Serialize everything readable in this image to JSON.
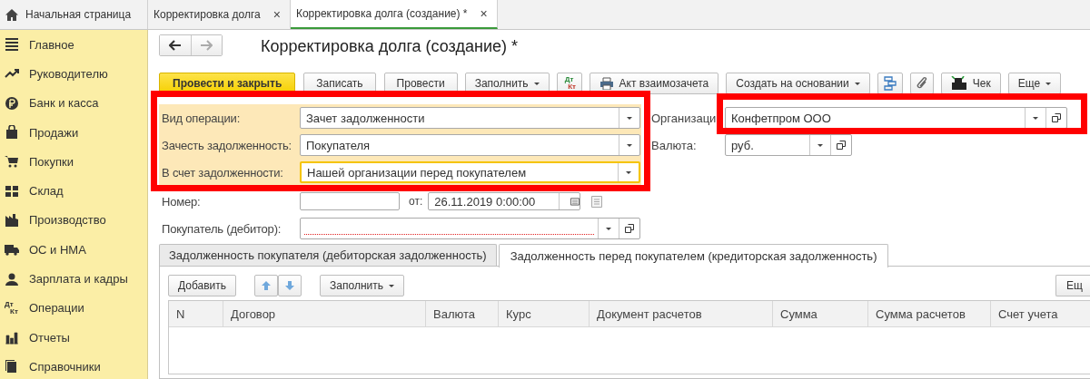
{
  "tabs": [
    {
      "label": "Начальная страница",
      "kind": "home",
      "selected": false
    },
    {
      "label": "Корректировка долга",
      "kind": "doc",
      "close": "×",
      "selected": false
    },
    {
      "label": "Корректировка долга (создание) *",
      "kind": "doc",
      "close": "×",
      "selected": true
    }
  ],
  "sidebar": {
    "items": [
      {
        "label": "Главное"
      },
      {
        "label": "Руководителю"
      },
      {
        "label": "Банк и касса"
      },
      {
        "label": "Продажи"
      },
      {
        "label": "Покупки"
      },
      {
        "label": "Склад"
      },
      {
        "label": "Производство"
      },
      {
        "label": "ОС и НМА"
      },
      {
        "label": "Зарплата и кадры"
      },
      {
        "label": "Операции",
        "icon_text": [
          "Дт",
          "Кт"
        ]
      },
      {
        "label": "Отчеты"
      },
      {
        "label": "Справочники"
      }
    ]
  },
  "form": {
    "title": "Корректировка долга (создание) *",
    "toolbar": [
      {
        "kind": "primary",
        "label": "Провести и закрыть"
      },
      {
        "kind": "plain",
        "label": "Записать"
      },
      {
        "kind": "plain",
        "label": "Провести"
      },
      {
        "kind": "dropdown",
        "label": "Заполнить"
      },
      {
        "kind": "dtkt",
        "icon_text": [
          "Дт",
          "Кт"
        ]
      },
      {
        "kind": "printer",
        "label": "Акт взаимозачета"
      },
      {
        "kind": "dropdown",
        "label": "Создать на основании"
      },
      {
        "kind": "structure"
      },
      {
        "kind": "clip"
      },
      {
        "kind": "register",
        "label": "Чек"
      },
      {
        "kind": "dropdown",
        "label": "Еще"
      }
    ],
    "operation_highlighted": true,
    "operation_fields": [
      {
        "label": "Вид операции:",
        "value": "Зачет задолженности",
        "focused": false
      },
      {
        "label": "Зачесть задолженность:",
        "value": "Покупателя",
        "focused": false
      },
      {
        "label": "В счет задолженности:",
        "value": "Нашей организации перед покупателем",
        "focused": true
      }
    ],
    "organization": {
      "label": "Организаци",
      "value": "Конфетпром ООО",
      "highlighted": true
    },
    "currency": {
      "label": "Валюта:",
      "value": "руб."
    },
    "number": {
      "label": "Номер:"
    },
    "date": {
      "label": "от:",
      "value": "26.11.2019  0:00:00"
    },
    "buyer": {
      "label": "Покупатель (дебитор):",
      "required": true
    },
    "doc_tabs": [
      {
        "label": "Задолженность покупателя (дебиторская задолженность)",
        "selected": false
      },
      {
        "label": "Задолженность перед покупателем (кредиторская задолженность)",
        "selected": true
      }
    ],
    "table_toolbar": [
      {
        "kind": "plain",
        "label": "Добавить"
      },
      {
        "kind": "arrows"
      },
      {
        "kind": "dropdown",
        "label": "Заполнить"
      },
      {
        "kind": "edge",
        "label": "Ещ"
      }
    ],
    "columns": [
      "N",
      "Договор",
      "Валюта",
      "Курс",
      "Документ расчетов",
      "Сумма",
      "Сумма расчетов",
      "Счет учета"
    ]
  }
}
